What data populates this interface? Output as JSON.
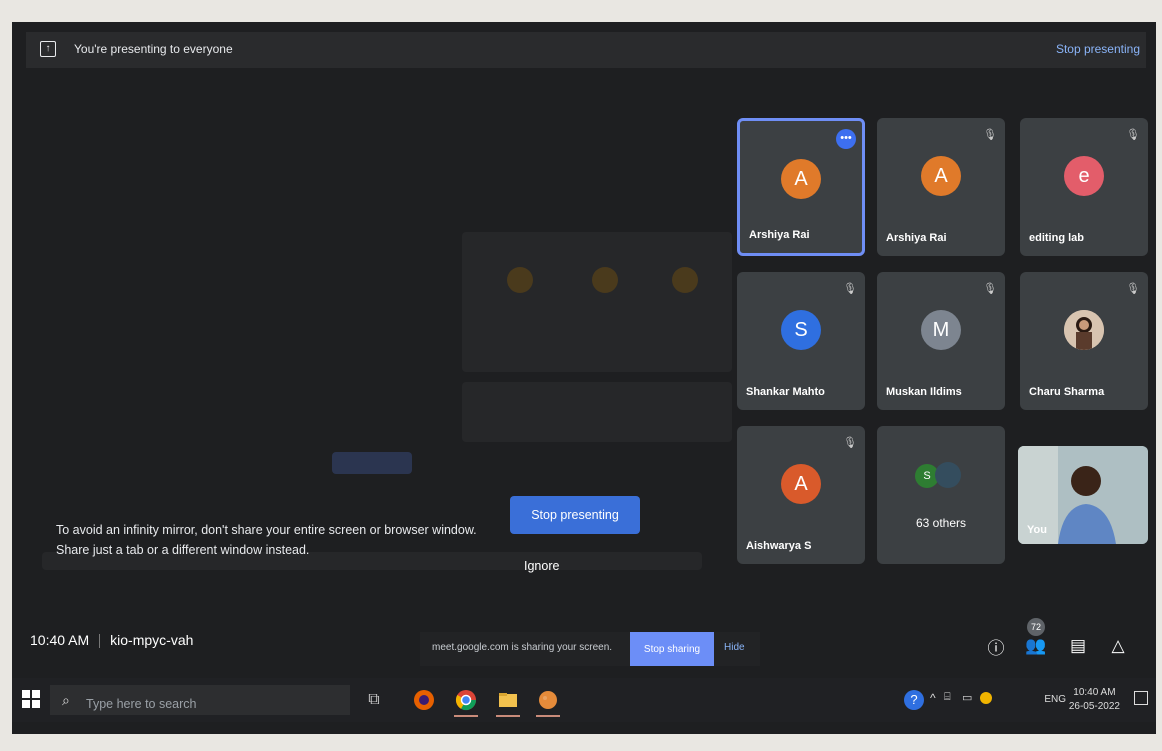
{
  "presenting_bar": {
    "text": "You're presenting to everyone",
    "stop_link": "Stop presenting"
  },
  "participants": [
    {
      "name": "Arshiya Rai",
      "initial": "A",
      "color": "#e07a2a",
      "active": true
    },
    {
      "name": "Arshiya Rai",
      "initial": "A",
      "color": "#e07a2a"
    },
    {
      "name": "editing lab",
      "initial": "e",
      "color": "#e35d6a"
    },
    {
      "name": "Shankar Mahto",
      "initial": "S",
      "color": "#2f6fe0"
    },
    {
      "name": "Muskan Ildims",
      "initial": "M",
      "color": "#7d8590"
    },
    {
      "name": "Charu Sharma",
      "initial": "",
      "color": "#d8c4b0"
    },
    {
      "name": "Aishwarya S",
      "initial": "A",
      "color": "#d95a2b"
    },
    {
      "name": "63 others",
      "initial": "S"
    },
    {
      "name": "You"
    }
  ],
  "infinity_mirror": {
    "message": "To avoid an infinity mirror, don't share your entire screen or browser window. Share just a tab or a different window instead.",
    "stop_button": "Stop presenting",
    "ignore_button": "Ignore"
  },
  "meeting": {
    "time": "10:40 AM",
    "code": "kio-mpyc-vah",
    "participant_count": "72"
  },
  "share_bar": {
    "text": "meet.google.com is sharing your screen.",
    "stop_button": "Stop sharing",
    "hide_button": "Hide"
  },
  "taskbar": {
    "search_placeholder": "Type here to search",
    "language": "ENG",
    "clock_time": "10:40 AM",
    "clock_date": "26-05-2022"
  }
}
